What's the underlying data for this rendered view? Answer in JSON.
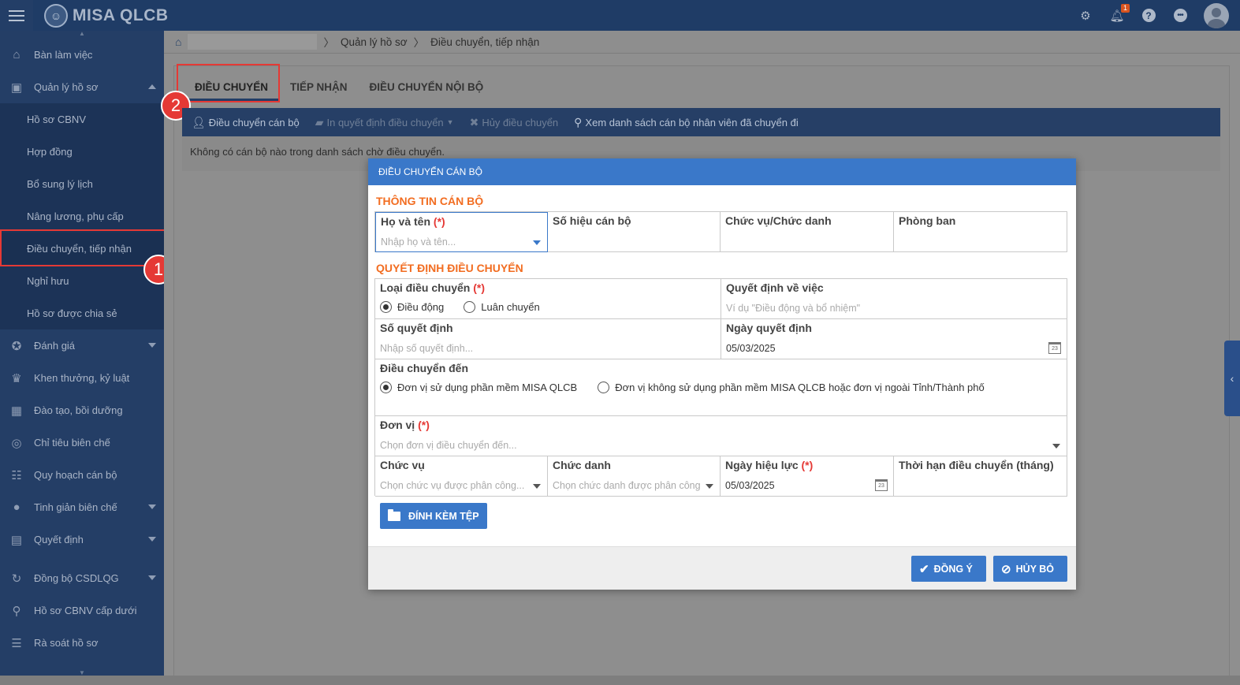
{
  "app": {
    "title": "MISA QLCB",
    "notification_count": "1"
  },
  "sidebar": {
    "items": [
      {
        "label": "Bàn làm việc",
        "icon": "home-icon"
      },
      {
        "label": "Quản lý hồ sơ",
        "icon": "briefcase-icon"
      },
      {
        "label": "Hồ sơ CBNV"
      },
      {
        "label": "Hợp đồng"
      },
      {
        "label": "Bổ sung lý lịch"
      },
      {
        "label": "Nâng lương, phụ cấp"
      },
      {
        "label": "Điều chuyển, tiếp nhận"
      },
      {
        "label": "Nghỉ hưu"
      },
      {
        "label": "Hồ sơ được chia sẻ"
      },
      {
        "label": "Đánh giá",
        "icon": "medal-icon"
      },
      {
        "label": "Khen thưởng, kỷ luật",
        "icon": "trophy-icon"
      },
      {
        "label": "Đào tạo, bồi dưỡng",
        "icon": "training-icon"
      },
      {
        "label": "Chỉ tiêu biên chế",
        "icon": "target-icon"
      },
      {
        "label": "Quy hoạch cán bộ",
        "icon": "people-icon"
      },
      {
        "label": "Tinh giản biên chế",
        "icon": "dots-icon"
      },
      {
        "label": "Quyết định",
        "icon": "clipboard-icon"
      },
      {
        "label": "Đồng bộ CSDLQG",
        "icon": "sync-icon"
      },
      {
        "label": "Hồ sơ CBNV cấp dưới",
        "icon": "search-icon"
      },
      {
        "label": "Rà soát hồ sơ",
        "icon": "list-icon"
      }
    ]
  },
  "breadcrumb": {
    "level1": "Quản lý hồ sơ",
    "level2": "Điều chuyển, tiếp nhận"
  },
  "tabs": [
    "ĐIỀU CHUYỂN",
    "TIẾP NHẬN",
    "ĐIỀU CHUYỂN NỘI BỘ"
  ],
  "toolbar": {
    "transfer": "Điều chuyển cán bộ",
    "print": "In quyết định điều chuyển",
    "cancel": "Hủy điều chuyển",
    "view": "Xem danh sách cán bộ nhân viên đã chuyển đi"
  },
  "empty_message": "Không có cán bộ nào trong danh sách chờ điều chuyển.",
  "annotations": {
    "one": "1",
    "two": "2"
  },
  "dialog": {
    "title": "ĐIỀU CHUYỂN CÁN BỘ",
    "section_staff": "THÔNG TIN CÁN BỘ",
    "section_decision": "QUYẾT ĐỊNH ĐIỀU CHUYỂN",
    "required_mark": "(*)",
    "full_name": {
      "label": "Họ và tên",
      "placeholder": "Nhập họ và tên..."
    },
    "staff_code": {
      "label": "Số hiệu cán bộ"
    },
    "position_title": {
      "label": "Chức vụ/Chức danh"
    },
    "department": {
      "label": "Phòng ban"
    },
    "transfer_type": {
      "label": "Loại điều chuyển",
      "opt1": "Điều động",
      "opt2": "Luân chuyển"
    },
    "decision_about": {
      "label": "Quyết định về việc",
      "placeholder": "Ví dụ \"Điều động và bổ nhiệm\""
    },
    "decision_no": {
      "label": "Số quyết định",
      "placeholder": "Nhập số quyết định..."
    },
    "decision_date": {
      "label": "Ngày quyết định",
      "value": "05/03/2025"
    },
    "transfer_to": {
      "label": "Điều chuyển đến",
      "opt1": "Đơn vị sử dụng phần mềm MISA QLCB",
      "opt2": "Đơn vị không sử dụng phần mềm MISA QLCB hoặc đơn vị ngoài Tỉnh/Thành phố"
    },
    "unit": {
      "label": "Đơn vị",
      "placeholder": "Chọn đơn vị điều chuyển đến..."
    },
    "position": {
      "label": "Chức vụ",
      "placeholder": "Chọn chức vụ được phân công..."
    },
    "title_field": {
      "label": "Chức danh",
      "placeholder": "Chọn chức danh được phân công"
    },
    "effective_date": {
      "label": "Ngày hiệu lực",
      "value": "05/03/2025"
    },
    "duration": {
      "label": "Thời hạn điều chuyển (tháng)"
    },
    "attach": "ĐÍNH KÈM TỆP",
    "ok": "ĐỒNG Ý",
    "cancel": "HỦY BỎ"
  }
}
